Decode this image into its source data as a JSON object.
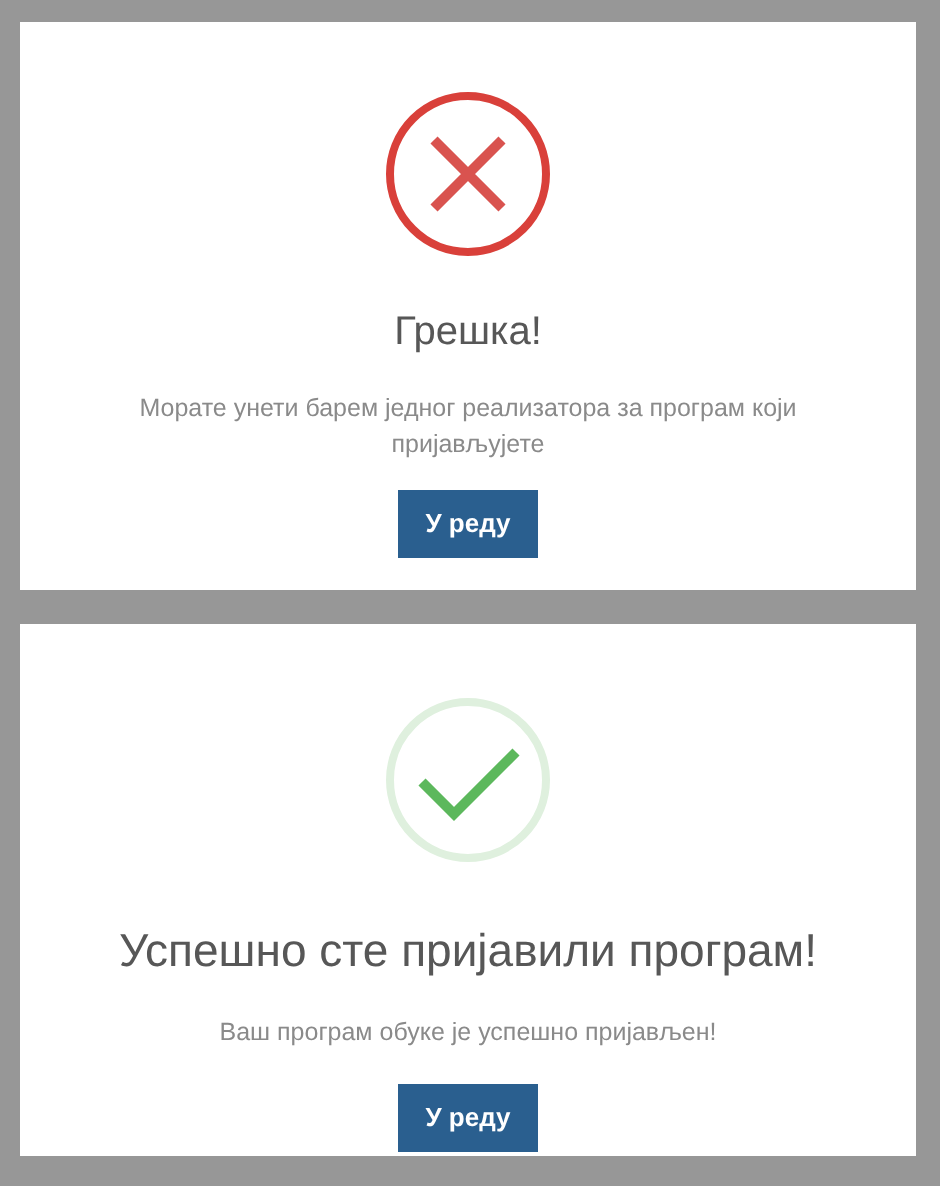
{
  "dialogs": [
    {
      "kind": "error",
      "title": "Грешка!",
      "message": "Морате унети барем једног реализатора за програм који пријављујете",
      "button": "У реду"
    },
    {
      "kind": "success",
      "title": "Успешно сте пријавили програм!",
      "message": "Ваш програм обуке је успешно пријављен!",
      "button": "У реду"
    }
  ]
}
